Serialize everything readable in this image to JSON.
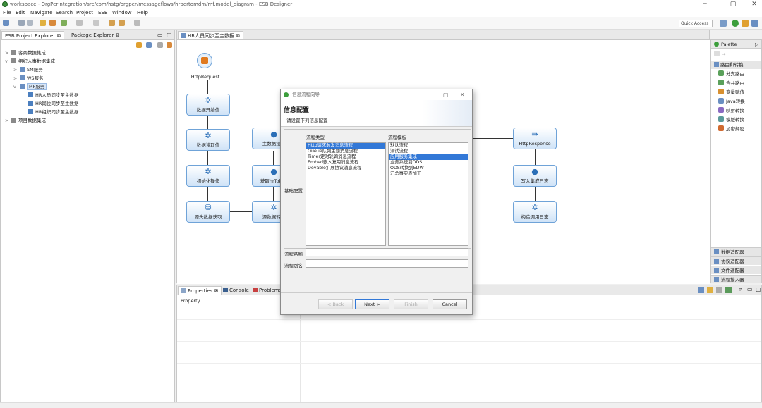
{
  "window": {
    "title": "workspace - OrgPerIntegration/src/com/hstg/orgper/messageflows/hrpertomdm/mf.model_diagram - ESB Designer"
  },
  "menu": [
    "File",
    "Edit",
    "Navigate",
    "Search",
    "Project",
    "ESB",
    "Window",
    "Help"
  ],
  "toolbar": {
    "quick_access": "Quick Access"
  },
  "left_panel": {
    "tabs": [
      "ESB Project Explorer",
      "Package Explorer"
    ],
    "tree": [
      {
        "label": "客商数据集成",
        "level": 0,
        "expander": ">"
      },
      {
        "label": "组织人事数据集成",
        "level": 0,
        "expander": "v"
      },
      {
        "label": "SM服务",
        "level": 1,
        "expander": ">"
      },
      {
        "label": "WS服务",
        "level": 1,
        "expander": ">"
      },
      {
        "label": "MF服务",
        "level": 1,
        "expander": "v"
      },
      {
        "label": "HR人员同步至主数据",
        "level": 2,
        "expander": ""
      },
      {
        "label": "HR岗位同步至主数据",
        "level": 2,
        "expander": ""
      },
      {
        "label": "HR组织同步至主数据",
        "level": 2,
        "expander": ""
      },
      {
        "label": "项目数据集成",
        "level": 0,
        "expander": ">"
      }
    ]
  },
  "editor": {
    "tab": "HR人员同步至主数据",
    "nodes": {
      "http_request": "HttpRequest",
      "n1": "数据开始值",
      "n2": "数据读取值",
      "n3": "初始化操作",
      "n4": "源头数据获取",
      "n5": "源数据转化",
      "n6": "获取hrToken",
      "n7": "主数据接口",
      "http_response": "HttpResponse",
      "n8": "写入集成日志",
      "n9": "构造调用日志"
    }
  },
  "palette": {
    "title": "Palette",
    "section": "路由和转换",
    "items": [
      "分支路由",
      "合并路由",
      "变量赋值",
      "Java转换",
      "映射转换",
      "模版转换",
      "加密解密"
    ],
    "bottom": [
      "数据适配器",
      "协议适配器",
      "文件适配器",
      "流程接入器"
    ]
  },
  "bottom_panel": {
    "tabs": [
      "Properties",
      "Console",
      "Problems"
    ],
    "property_header": "Property"
  },
  "dialog": {
    "title": "信息流程向导",
    "heading": "信息配置",
    "subheading": "请设置下列信息配置",
    "group_label": "基础配置",
    "type_label": "流程类型",
    "template_label": "流程模板",
    "types": [
      "Http请求触发消息流程",
      "Queue队列主题消息流程",
      "Timer定时轮询消息流程",
      "Embed嵌入复用消息流程",
      "Devable扩展协议消息流程"
    ],
    "selected_type": 0,
    "templates": [
      "默认流程",
      "测试流程",
      "应用服务集成",
      "业务系统到ODS",
      "ODS转换到EDW",
      "汇总事实表加工"
    ],
    "selected_template": 2,
    "name_label": "流程名称",
    "alias_label": "流程别名",
    "name_value": "",
    "alias_value": "",
    "buttons": {
      "back": "< Back",
      "next": "Next >",
      "finish": "Finish",
      "cancel": "Cancel"
    }
  }
}
